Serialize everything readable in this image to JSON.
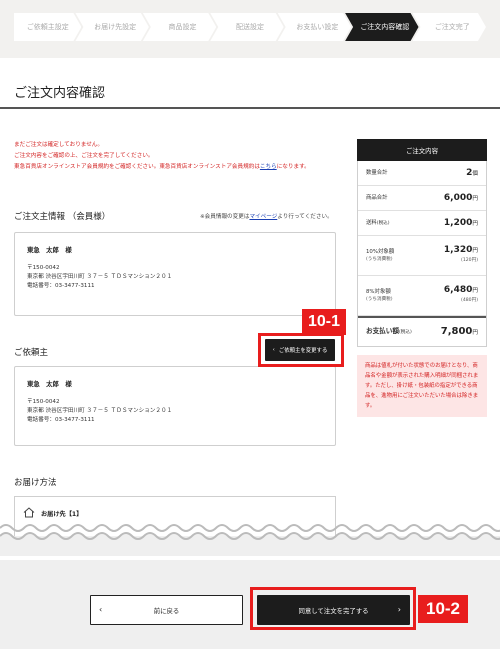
{
  "stepper": {
    "steps": [
      "ご依頼主設定",
      "お届け先設定",
      "商品設定",
      "配送設定",
      "お支払い設定",
      "ご注文内容確認",
      "ご注文完了"
    ],
    "active_index": 5
  },
  "page": {
    "title": "ご注文内容確認"
  },
  "notice": {
    "line1": "まだご注文は確定しておりません。",
    "line2": "ご注文内容をご確認の上、ご注文を完了してください。",
    "line3_before": "東急百貨店オンラインストア会員規約をご確認ください。東急百貨店オンラインストア会員規約は",
    "line3_link": "こちら",
    "line3_after": "になります。"
  },
  "orderer": {
    "title": "ご注文主情報 （会員様）",
    "note_before": "※会員情報の変更は",
    "note_link": "マイページ",
    "note_after": "より行ってください。",
    "name": "東急　太郎　様",
    "postal": "〒150-0042",
    "address": "東京都 渋谷区宇田川町 ３７－５ ＴＤＳマンション２０１",
    "phone": "電話番号：03-3477-3111"
  },
  "requester": {
    "title": "ご依頼主",
    "change_button": "ご依頼主を変更する",
    "name": "東急　太郎　様",
    "postal": "〒150-0042",
    "address": "東京都 渋谷区宇田川町 ３７－５ ＴＤＳマンション２０１",
    "phone": "電話番号：03-3477-3111"
  },
  "delivery": {
    "title": "お届け方法",
    "destination_label": "お届け先【1】"
  },
  "summary": {
    "header": "ご注文内容",
    "rows": [
      {
        "label": "数量合計",
        "value": "2",
        "unit": "個"
      },
      {
        "label": "商品合計",
        "value": "6,000",
        "unit": "円"
      },
      {
        "label": "送料",
        "label_sub": "(税込)",
        "value": "1,200",
        "unit": "円"
      },
      {
        "label": "10%対象額",
        "label_sub": "(うち消費税)",
        "value": "1,320",
        "unit": "円",
        "value_sub": "(120円)"
      },
      {
        "label": "8%対象額",
        "label_sub": "(うち消費税)",
        "value": "6,480",
        "unit": "円",
        "value_sub": "(480円)"
      }
    ],
    "total_label": "お支払い額",
    "total_label_sub": "(税込)",
    "total_value": "7,800",
    "total_unit": "円",
    "note": "商品は値札が付いた状態でのお届けとなり、商品名や金額が表示された購入明細が同梱されます。ただし、掛け紙・包装紙の指定ができる商品を、進物用にご注文いただいた場合は除きます。"
  },
  "footer": {
    "back_label": "前に戻る",
    "submit_label": "同意して注文を完了する"
  },
  "callouts": {
    "c1": "10-1",
    "c2": "10-2"
  },
  "colors": {
    "accent_red": "#e81d1d",
    "dark": "#1c1c1c",
    "notice_red": "#d21f1f",
    "link_blue": "#1a3fb3"
  },
  "icons": {
    "home": "home-icon",
    "chevron_left": "chevron-left-icon",
    "chevron_right": "chevron-right-icon"
  }
}
